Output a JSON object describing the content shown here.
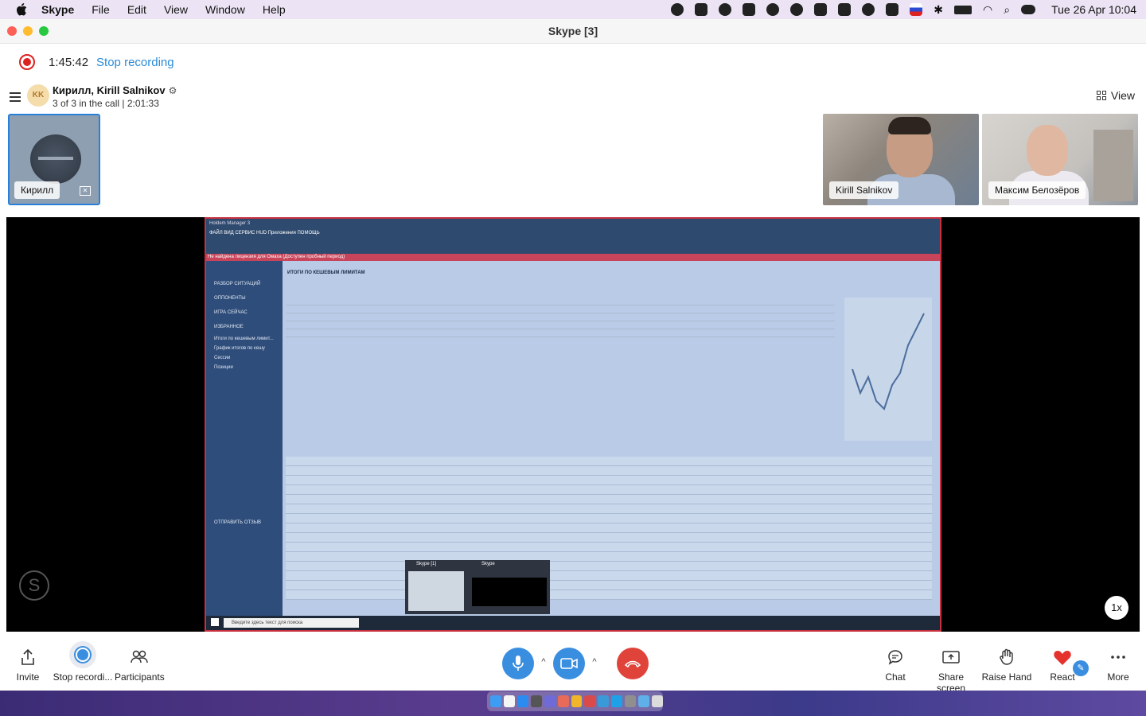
{
  "menubar": {
    "app_name": "Skype",
    "items": [
      "File",
      "Edit",
      "View",
      "Window",
      "Help"
    ],
    "clock": "Tue 26 Apr  10:04"
  },
  "window": {
    "title": "Skype [3]"
  },
  "recording": {
    "elapsed": "1:45:42",
    "stop_label": "Stop recording"
  },
  "call": {
    "avatar_initials": "KK",
    "name": "Кирилл, Kirill Salnikov",
    "subtitle": "3 of 3 in the call | 2:01:33",
    "view_label": "View"
  },
  "participants": [
    {
      "name": "Кирилл"
    },
    {
      "name": "Kirill Salnikov"
    },
    {
      "name": "Максим Белозёров"
    }
  ],
  "shared_screen": {
    "app_title": "Holdem Manager 3",
    "menu": "ФАЙЛ  ВИД  СЕРВИС  HUD  Приложения  ПОМОЩЬ",
    "warning": "Не найдена лицензия для Омаха (Доступен пробный период)",
    "section_title": "ИТОГИ ПО КЕШЕВЫМ ЛИМИТАМ",
    "sidebar_items": [
      "РАЗБОР СИТУАЦИЙ",
      "ОППОНЕНТЫ",
      "ИГРА СЕЙЧАС",
      "ИЗБРАННОЕ",
      "Итоги по кешевым лимит...",
      "График итогов по кешу",
      "Сессии",
      "Позиции",
      "ОТПРАВИТЬ ОТЗЫВ"
    ],
    "taskbar_search": "Введите здесь текст для поиска",
    "popup_labels": [
      "Skype [1]",
      "Skype"
    ]
  },
  "playback_speed": "1x",
  "toolbar": {
    "invite": "Invite",
    "stop_recording": "Stop recordi...",
    "participants": "Participants",
    "chat": "Chat",
    "share_screen": "Share screen",
    "raise_hand": "Raise Hand",
    "react": "React",
    "more": "More"
  },
  "colors": {
    "accent": "#3a8ee0",
    "end_call": "#e0433a",
    "recording": "#dd2222"
  }
}
